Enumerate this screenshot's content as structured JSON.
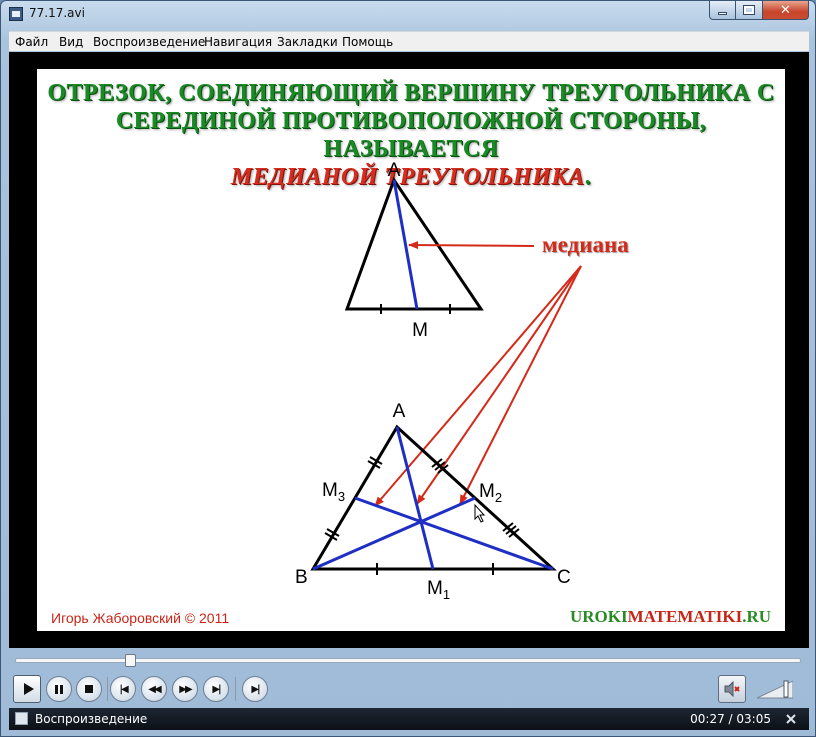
{
  "window": {
    "title": "77.17.avi",
    "buttons": {
      "minimize": "",
      "maximize": "",
      "close": "✕"
    }
  },
  "menu": {
    "items": [
      "Файл",
      "Вид",
      "Воспроизведение",
      "Навигация",
      "Закладки",
      "Помощь"
    ]
  },
  "slide": {
    "heading_line1": "ОТРЕЗОК, СОЕДИНЯЮЩИЙ ВЕРШИНУ ТРЕУГОЛЬНИКА С",
    "heading_line2": "СЕРЕДИНОЙ ПРОТИВОПОЛОЖНОЙ СТОРОНЫ, НАЗЫВАЕТСЯ",
    "heading_line3": "МЕДИАНОЙ ТРЕУГОЛЬНИКА",
    "heading_period": ".",
    "label_median": "медиана",
    "small_triangle": {
      "vertex_a": "A",
      "midpoint_m": "M"
    },
    "big_triangle": {
      "vertex_a": "A",
      "vertex_b": "B",
      "vertex_c": "C",
      "m1_letter": "M",
      "m1_sub": "1",
      "m2_letter": "M",
      "m2_sub": "2",
      "m3_letter": "M",
      "m3_sub": "3"
    },
    "credit_left": "Игорь Жаборовский © 2011",
    "credit_right_a": "UROKI",
    "credit_right_b": "MATEMATIKI",
    "credit_right_c": ".RU",
    "colors": {
      "heading_green": "#1a8a25",
      "heading_red": "#d82c1e",
      "median_blue": "#1f2fc4",
      "arrow_red": "#d42a1a"
    }
  },
  "player": {
    "seek_progress": 0.146,
    "controls": [
      "play-icon",
      "pause-icon",
      "stop-icon",
      "skip-back-icon",
      "rewind-icon",
      "fast-forward-icon",
      "skip-forward-icon",
      "frame-step-icon"
    ],
    "mute_icon": "speaker-muted-icon"
  },
  "status": {
    "text": "Воспроизведение",
    "time": "00:27 / 03:05"
  }
}
